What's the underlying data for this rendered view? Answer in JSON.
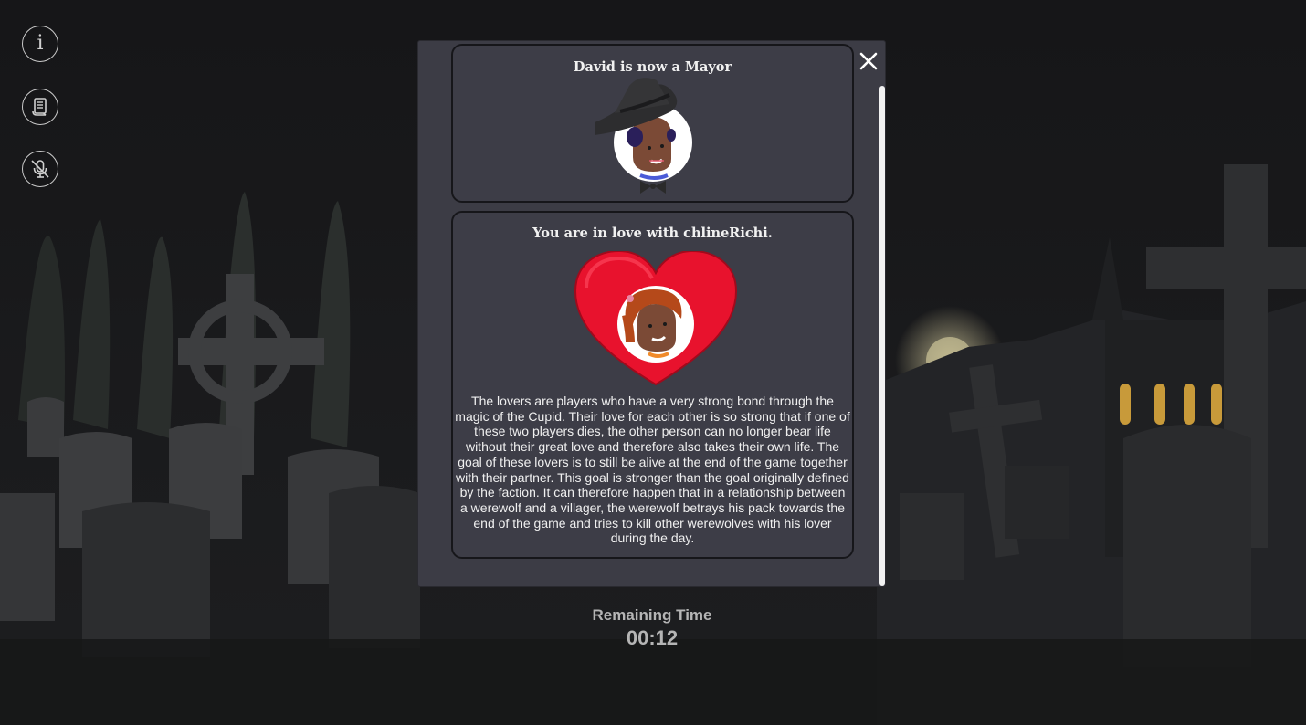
{
  "sidebar": {
    "info_icon": "info-icon",
    "rules_icon": "scroll-icon",
    "mic_icon": "microphone-muted-icon"
  },
  "announcements": [
    {
      "title": "David is now a Mayor",
      "avatar": "player-avatar-with-top-hat"
    },
    {
      "title": "You are in love with chlineRichi.",
      "avatar": "lover-avatar-in-heart",
      "description": "The lovers are players who have a very strong bond through the magic of the Cupid. Their love for each other is so strong that if one of these two players dies, the other person can no longer bear life without their great love and therefore also takes their own life. The goal of these lovers is to still be alive at the end of the game together with their partner. This goal is stronger than the goal originally defined by the faction. It can therefore happen that in a relationship between a werewolf and a villager, the werewolf betrays his pack towards the end of the game and tries to kill other werewolves with his lover during the day."
    }
  ],
  "timer": {
    "label": "Remaining Time",
    "value": "00:12"
  },
  "colors": {
    "modal_bg": "#3c3c45",
    "heart": "#e8122d",
    "text": "#f1f1f1",
    "timer": "#b5b5b5"
  }
}
